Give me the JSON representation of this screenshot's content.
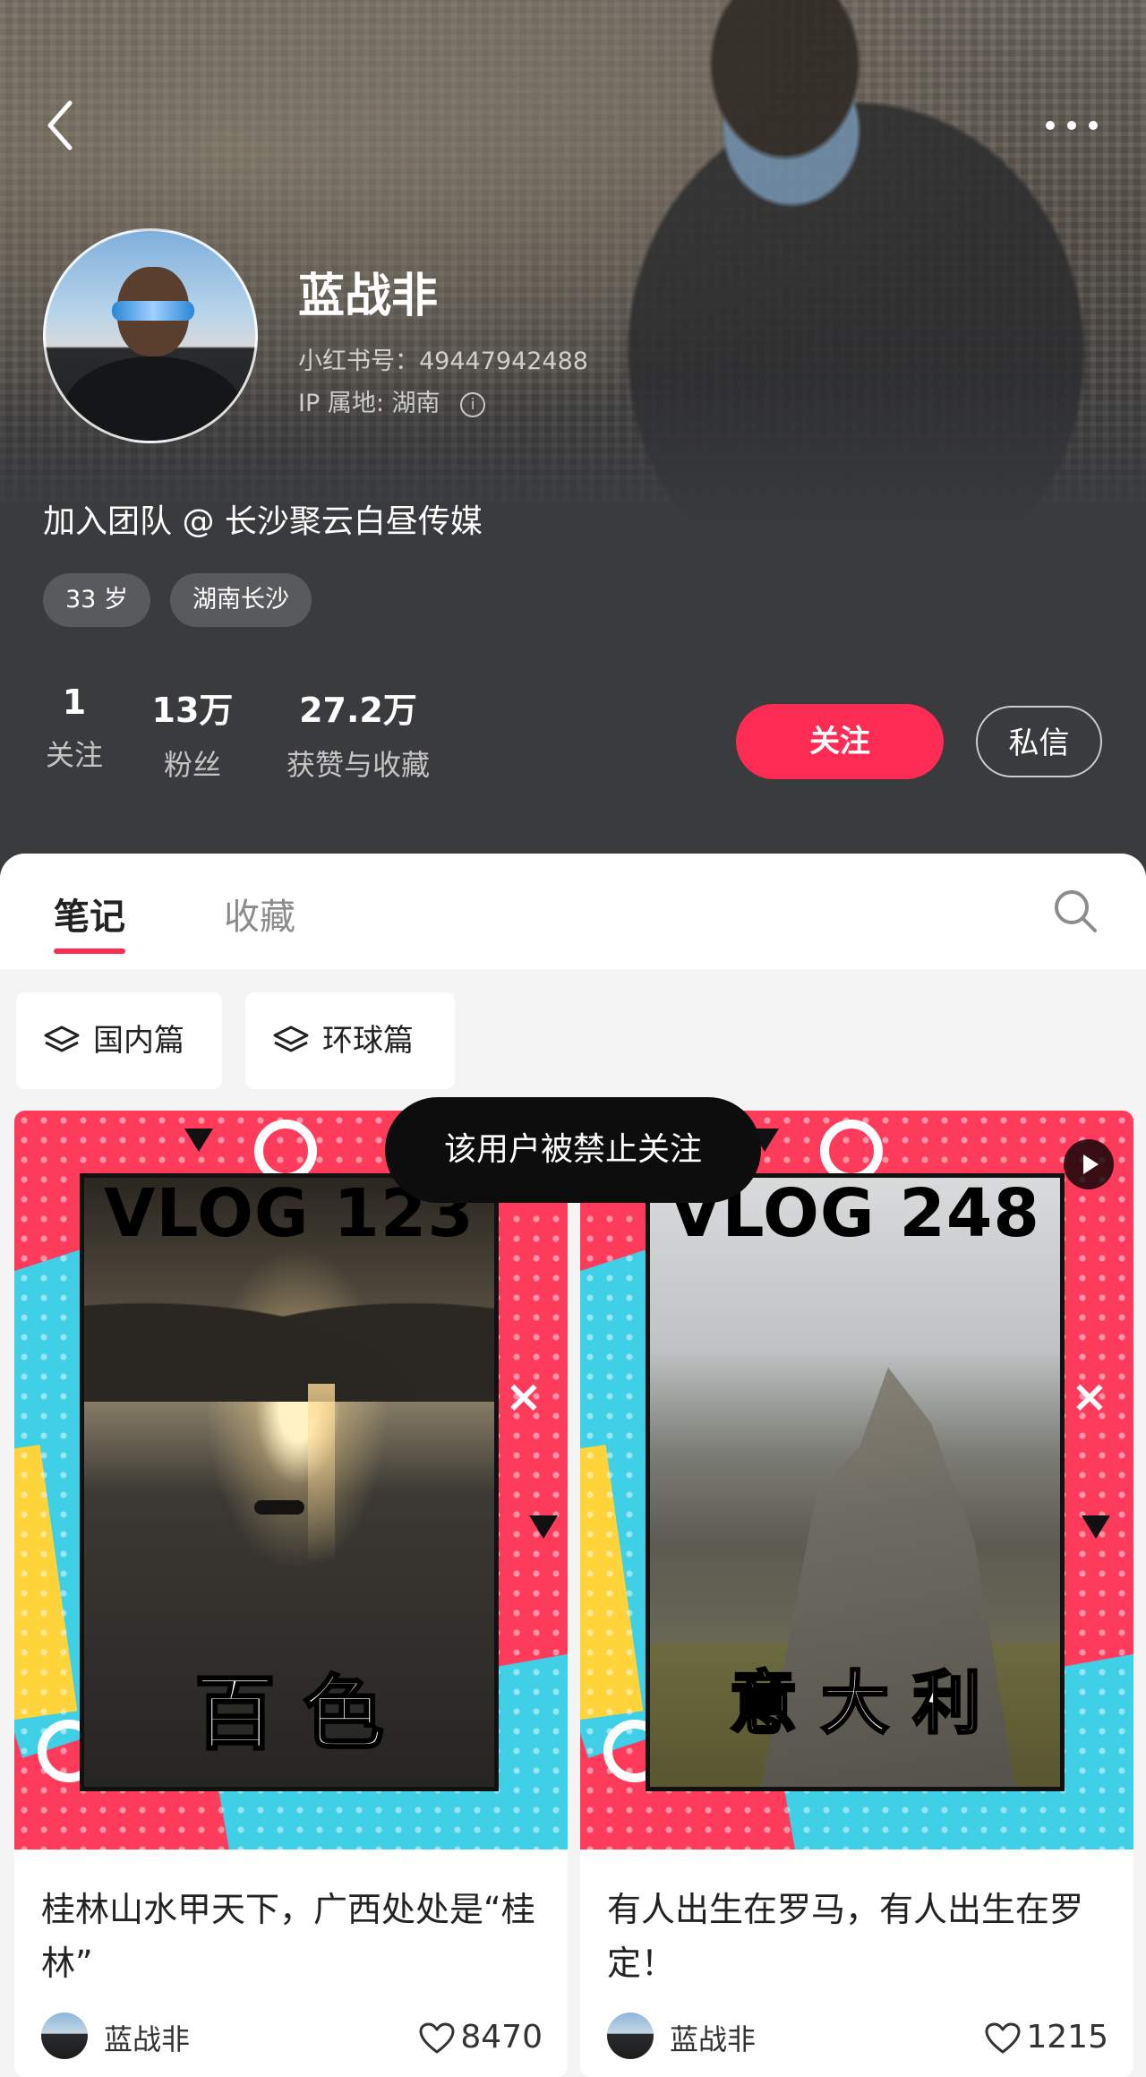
{
  "profile": {
    "name": "蓝战非",
    "id_label": "小红书号：49447942488",
    "ip_label": "IP 属地: 湖南",
    "bio": "加入团队 @ 长沙聚云白昼传媒",
    "tags": [
      "33 岁",
      "湖南长沙"
    ]
  },
  "stats": [
    {
      "value": "1",
      "label": "关注"
    },
    {
      "value": "13万",
      "label": "粉丝"
    },
    {
      "value": "27.2万",
      "label": "获赞与收藏"
    }
  ],
  "actions": {
    "follow": "关注",
    "message": "私信"
  },
  "tabs": [
    {
      "label": "笔记",
      "active": true
    },
    {
      "label": "收藏",
      "active": false
    }
  ],
  "collections": [
    "国内篇",
    "环球篇"
  ],
  "toast": "该用户被禁止关注",
  "notes": [
    {
      "cover_title": "VLOG 123",
      "cover_place": "百 色",
      "title": "桂林山水甲天下，广西处处是“桂林”",
      "author": "蓝战非",
      "likes": "8470"
    },
    {
      "cover_title": "VLOG 248",
      "cover_place": "意 大 利",
      "title": "有人出生在罗马，有人出生在罗定！",
      "author": "蓝战非",
      "likes": "1215"
    }
  ],
  "icons": [
    "back-icon",
    "more-icon",
    "info-icon",
    "search-icon",
    "layers-icon",
    "play-icon",
    "heart-icon"
  ],
  "colors": {
    "accent": "#fe2c55",
    "header_bg": "#3a3b3d",
    "toast_bg": "#0d0d0d"
  }
}
